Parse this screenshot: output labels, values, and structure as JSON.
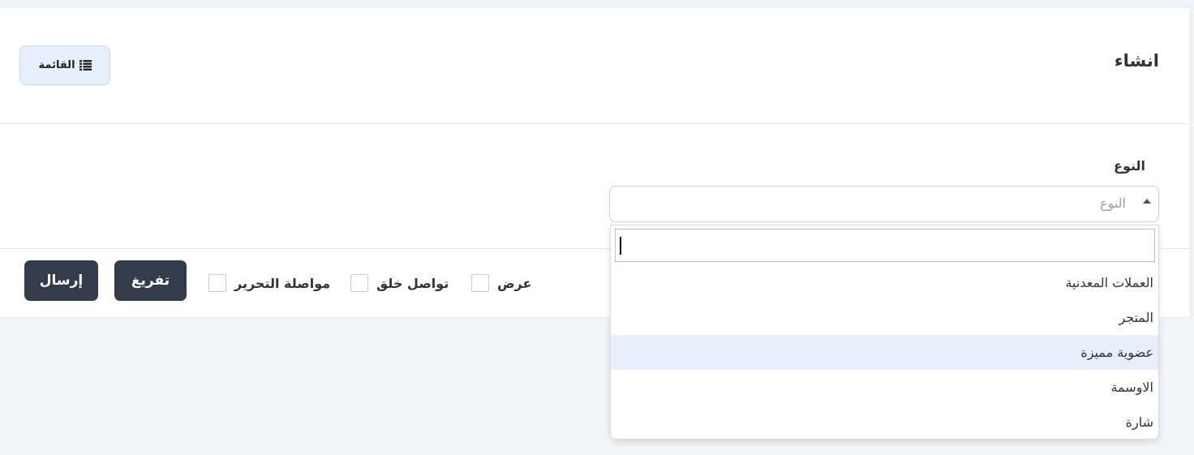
{
  "header": {
    "title": "انشاء",
    "list_button_label": "القائمة"
  },
  "form": {
    "type_label": "النوع",
    "type_placeholder": "النوع"
  },
  "dropdown": {
    "search_value": "",
    "options": [
      {
        "label": "العملات المعدنية",
        "highlighted": false
      },
      {
        "label": "المتجر",
        "highlighted": false
      },
      {
        "label": "عضوية مميزة",
        "highlighted": true
      },
      {
        "label": "الاوسمة",
        "highlighted": false
      },
      {
        "label": "شارة",
        "highlighted": false
      }
    ]
  },
  "footer": {
    "submit_label": "إرسال",
    "reset_label": "تفريغ",
    "checkboxes": [
      {
        "label": "مواصلة التحرير",
        "checked": false
      },
      {
        "label": "تواصل خلق",
        "checked": false
      },
      {
        "label": "عرض",
        "checked": false
      }
    ]
  },
  "colors": {
    "primary_dark": "#343c4c",
    "list_button_bg": "#e7effc",
    "highlight_bg": "#e8effa",
    "page_bg": "#f3f4f8"
  }
}
